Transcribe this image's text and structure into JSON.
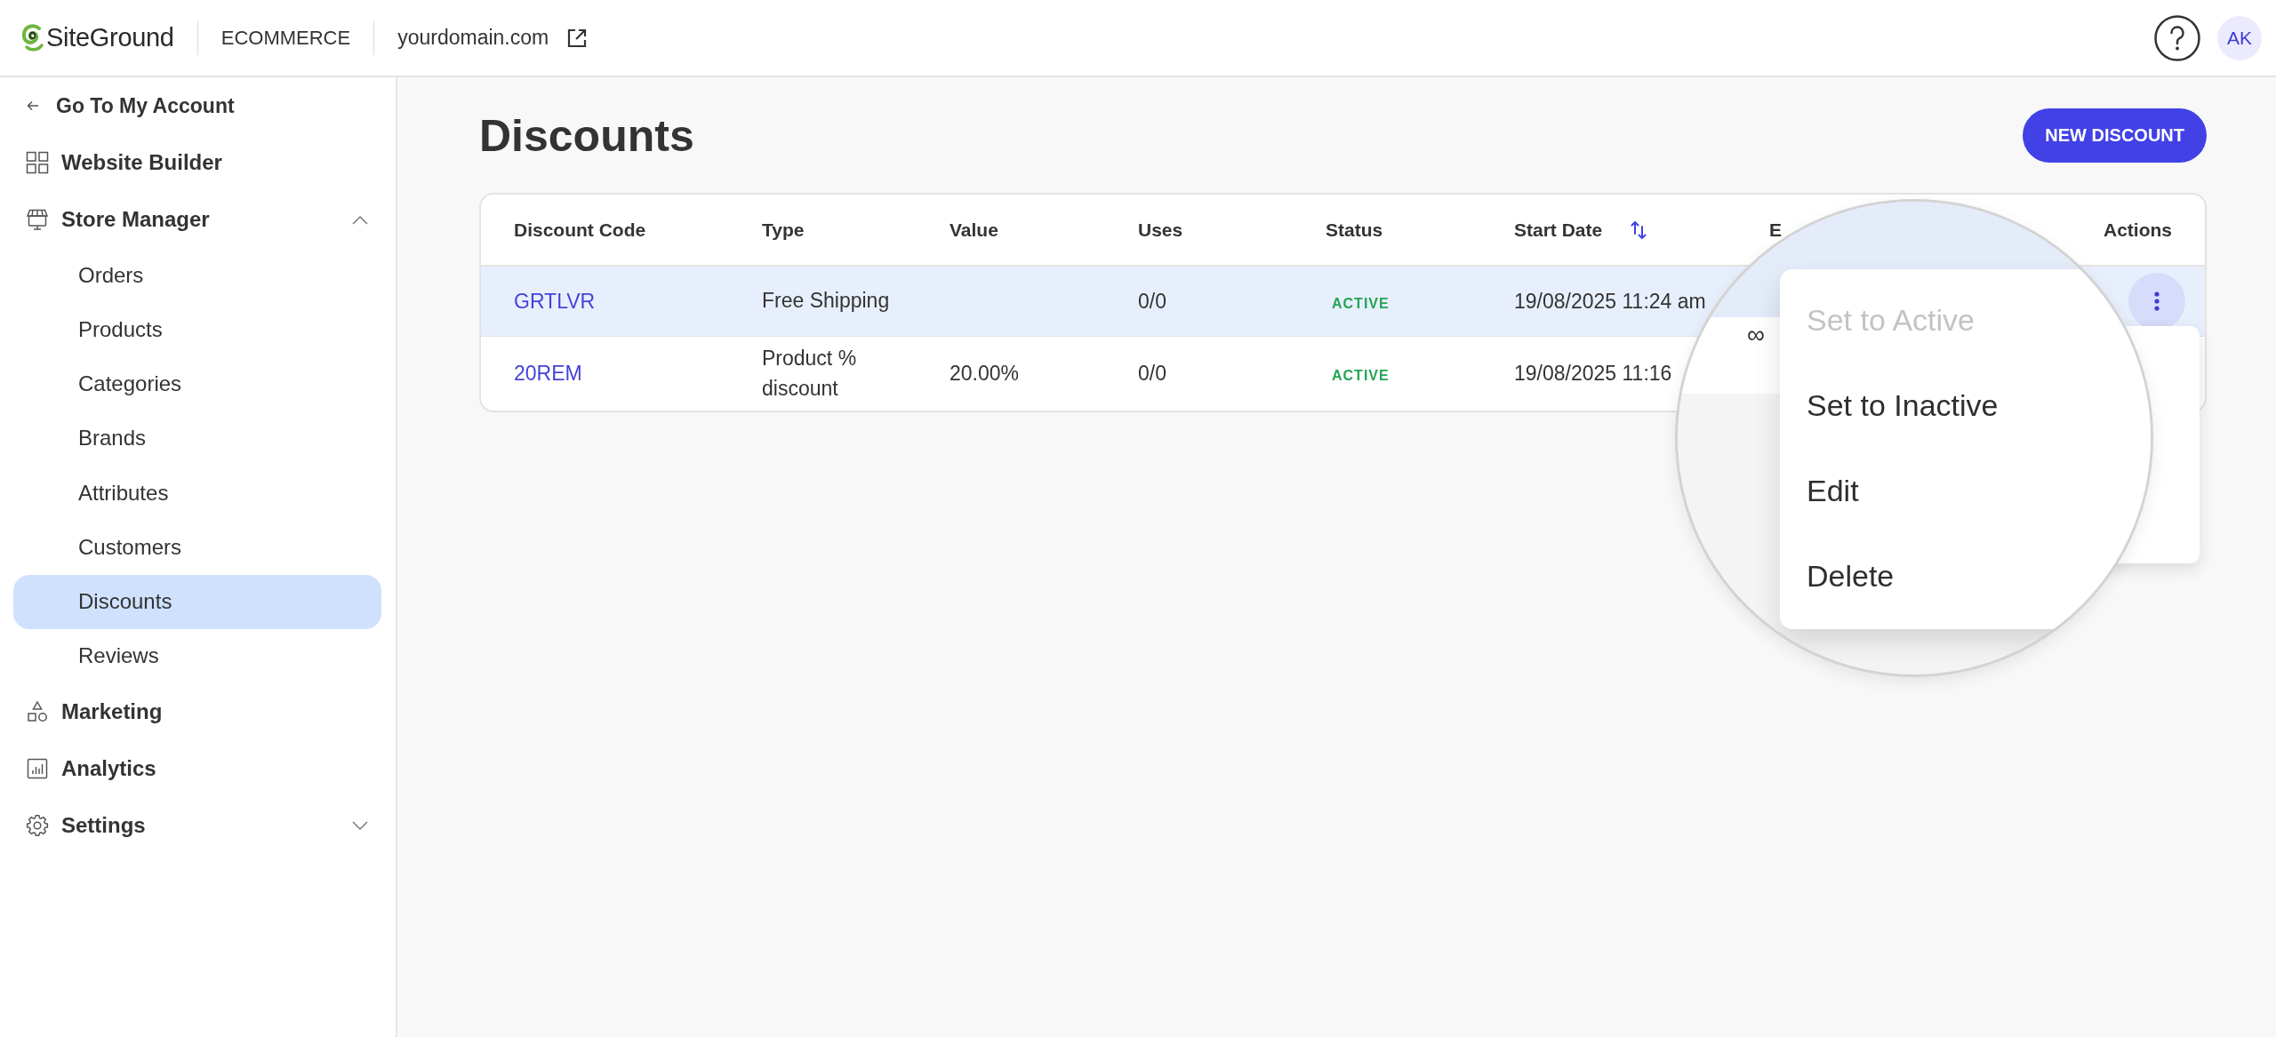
{
  "header": {
    "brand": "SiteGround",
    "section": "ECOMMERCE",
    "domain": "yourdomain.com",
    "avatar": "AK"
  },
  "sidebar": {
    "back": "Go To My Account",
    "items": [
      {
        "label": "Website Builder",
        "kind": "link"
      },
      {
        "label": "Store Manager",
        "kind": "group",
        "expanded": true,
        "children": [
          {
            "label": "Orders",
            "selected": false
          },
          {
            "label": "Products",
            "selected": false
          },
          {
            "label": "Categories",
            "selected": false
          },
          {
            "label": "Brands",
            "selected": false
          },
          {
            "label": "Attributes",
            "selected": false
          },
          {
            "label": "Customers",
            "selected": false
          },
          {
            "label": "Discounts",
            "selected": true
          },
          {
            "label": "Reviews",
            "selected": false
          }
        ]
      },
      {
        "label": "Marketing",
        "kind": "link"
      },
      {
        "label": "Analytics",
        "kind": "link"
      },
      {
        "label": "Settings",
        "kind": "group",
        "expanded": false
      }
    ]
  },
  "page": {
    "title": "Discounts",
    "new_button": "NEW DISCOUNT"
  },
  "table": {
    "columns": [
      {
        "label": "Discount Code",
        "sorted": false
      },
      {
        "label": "Type",
        "sorted": false
      },
      {
        "label": "Value",
        "sorted": false
      },
      {
        "label": "Uses",
        "sorted": false
      },
      {
        "label": "Status",
        "sorted": false
      },
      {
        "label": "Start Date",
        "sorted": true
      },
      {
        "label": "E",
        "sorted": false
      },
      {
        "label": "Actions",
        "sorted": false
      }
    ],
    "rows": [
      {
        "code": "GRTLVR",
        "type": "Free Shipping",
        "uses": "0/0",
        "status": "ACTIVE",
        "start_date": "19/08/2025 11:24 am",
        "selected": true
      },
      {
        "code": "20REM",
        "type": "Product % discount",
        "value": "20.00%",
        "uses": "0/0",
        "status": "ACTIVE",
        "start_date": "19/08/2025 11:16",
        "selected": false
      }
    ]
  },
  "magnifier": {
    "cell": "∞",
    "menu": [
      {
        "label": "Set to Active",
        "disabled": true
      },
      {
        "label": "Set to Inactive",
        "disabled": false
      },
      {
        "label": "Edit",
        "disabled": false
      },
      {
        "label": "Delete",
        "disabled": false
      }
    ]
  }
}
